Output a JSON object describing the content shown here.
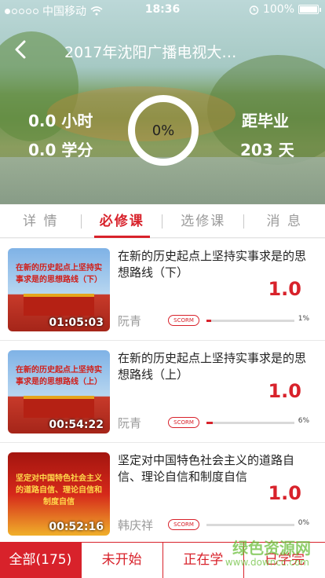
{
  "status_bar": {
    "carrier": "中国移动",
    "time": "18:36",
    "battery": "100%"
  },
  "header": {
    "title": "2017年沈阳广播电视大…",
    "hours": "0.0 小时",
    "credits": "0.0 学分",
    "progress": "0%",
    "graduation_label": "距毕业",
    "graduation_days": "203 天"
  },
  "tabs": [
    {
      "label": "详 情"
    },
    {
      "label": "必修课"
    },
    {
      "label": "选修课"
    },
    {
      "label": "消 息"
    }
  ],
  "courses": [
    {
      "thumb_text": "在新的历史起点上坚持实事求是的思想路线（下）",
      "duration": "01:05:03",
      "title": "在新的历史起点上坚持实事求是的思想路线（下）",
      "credit": "1.0",
      "teacher": "阮青",
      "badge": "SCORM",
      "progress_value": 0.01,
      "progress_text": "1%"
    },
    {
      "thumb_text": "在新的历史起点上坚持实事求是的思想路线（上）",
      "duration": "00:54:22",
      "title": "在新的历史起点上坚持实事求是的思想路线（上）",
      "credit": "1.0",
      "teacher": "阮青",
      "badge": "SCORM",
      "progress_value": 0.06,
      "progress_text": "6%"
    },
    {
      "thumb_text": "坚定对中国特色社会主义的道路自信、理论自信和制度自信",
      "duration": "00:52:16",
      "title": "坚定对中国特色社会主义的道路自信、理论自信和制度自信",
      "credit": "1.0",
      "teacher": "韩庆祥",
      "badge": "SCORM",
      "progress_value": 0.0,
      "progress_text": "0%"
    }
  ],
  "filters": [
    {
      "label": "全部(175)"
    },
    {
      "label": "未开始"
    },
    {
      "label": "正在学"
    },
    {
      "label": "已学完"
    }
  ],
  "watermark": {
    "text": "绿色资源网",
    "sub": "www.downcc.com"
  },
  "colors": {
    "accent": "#d8222b",
    "inactive_tab": "#9a9a9a"
  }
}
